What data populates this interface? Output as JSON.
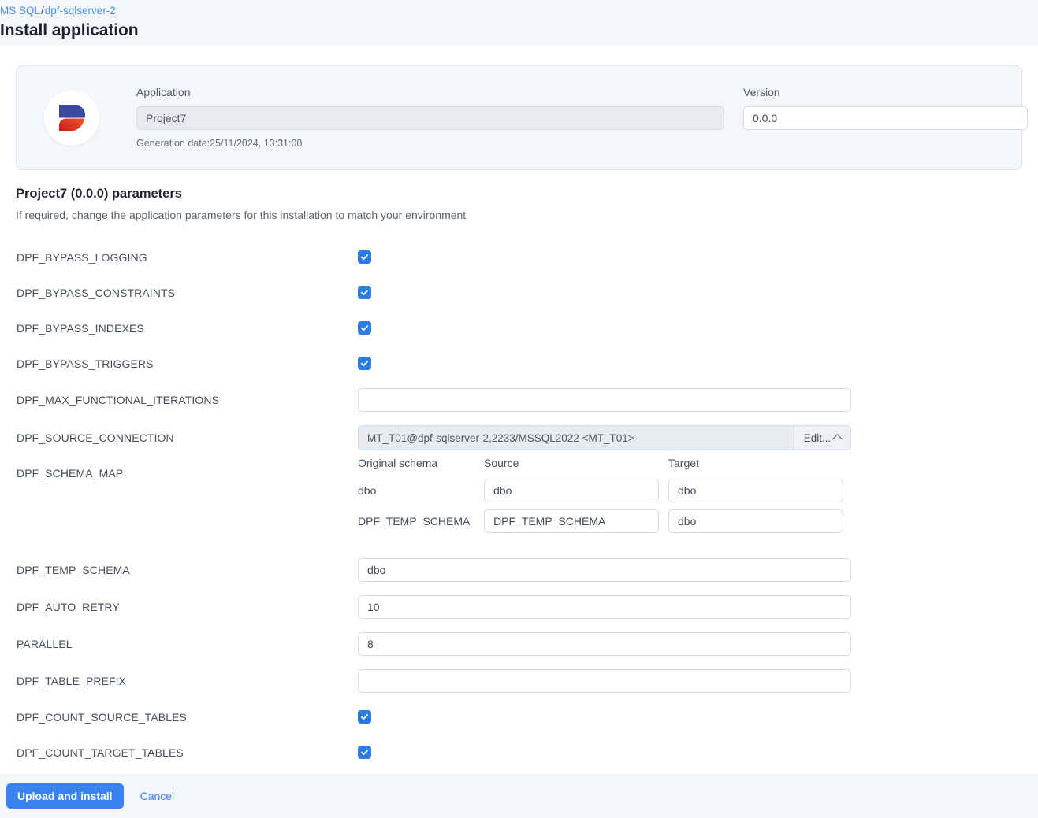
{
  "header": {
    "breadcrumb": {
      "root": "MS SQL",
      "separator": "/",
      "current": "dpf-sqlserver-2"
    },
    "title": "Install application"
  },
  "app_card": {
    "logo_icon": "dpf-logo-icon",
    "logo_colors": {
      "top": "#3c4a9e",
      "bottom_start": "#c8161d",
      "bottom_end": "#f05a28"
    },
    "application": {
      "label": "Application",
      "value": "Project7",
      "placeholder": "",
      "disabled": true
    },
    "version": {
      "label": "Version",
      "value": "0.0.0",
      "placeholder": ""
    },
    "generation_date": "Generation date:25/11/2024, 13:31:00"
  },
  "params_section": {
    "title": "Project7 (0.0.0) parameters",
    "subtitle": "If required, change the application parameters for this installation to match your environment"
  },
  "parameters": [
    {
      "name": "DPF_BYPASS_LOGGING",
      "type": "checkbox",
      "checked": true
    },
    {
      "name": "DPF_BYPASS_CONSTRAINTS",
      "type": "checkbox",
      "checked": true
    },
    {
      "name": "DPF_BYPASS_INDEXES",
      "type": "checkbox",
      "checked": true
    },
    {
      "name": "DPF_BYPASS_TRIGGERS",
      "type": "checkbox",
      "checked": true
    },
    {
      "name": "DPF_MAX_FUNCTIONAL_ITERATIONS",
      "type": "text",
      "value": "",
      "placeholder": ""
    },
    {
      "name": "DPF_SOURCE_CONNECTION",
      "type": "combo",
      "value": "MT_T01@dpf-sqlserver-2,2233/MSSQL2022 <MT_T01>",
      "button_label": "Edit...",
      "button_icon": "chevron-up-icon"
    },
    {
      "name": "DPF_SCHEMA_MAP",
      "type": "schema-map"
    },
    {
      "name": "DPF_TEMP_SCHEMA",
      "type": "text",
      "value": "dbo",
      "placeholder": ""
    },
    {
      "name": "DPF_AUTO_RETRY",
      "type": "text",
      "value": "10",
      "placeholder": ""
    },
    {
      "name": "PARALLEL",
      "type": "text",
      "value": "8",
      "placeholder": ""
    },
    {
      "name": "DPF_TABLE_PREFIX",
      "type": "text",
      "value": "",
      "placeholder": ""
    },
    {
      "name": "DPF_COUNT_SOURCE_TABLES",
      "type": "checkbox",
      "checked": true
    },
    {
      "name": "DPF_COUNT_TARGET_TABLES",
      "type": "checkbox",
      "checked": true
    }
  ],
  "schema_map": {
    "columns": [
      "Original schema",
      "Source",
      "Target"
    ],
    "rows": [
      {
        "original": "dbo",
        "source": "dbo",
        "target": "dbo"
      },
      {
        "original": "DPF_TEMP_SCHEMA",
        "source": "DPF_TEMP_SCHEMA",
        "target": "dbo"
      }
    ]
  },
  "footer": {
    "primary_label": "Upload and install",
    "cancel_label": "Cancel"
  },
  "colors": {
    "accent": "#3a82ef",
    "link": "#4a90f0",
    "checkbox": "#2c7be5",
    "page_bg": "#f4f7fa",
    "panel_bg": "#ffffff",
    "card_bg": "#f3f7fa",
    "border": "#d3dce5"
  }
}
